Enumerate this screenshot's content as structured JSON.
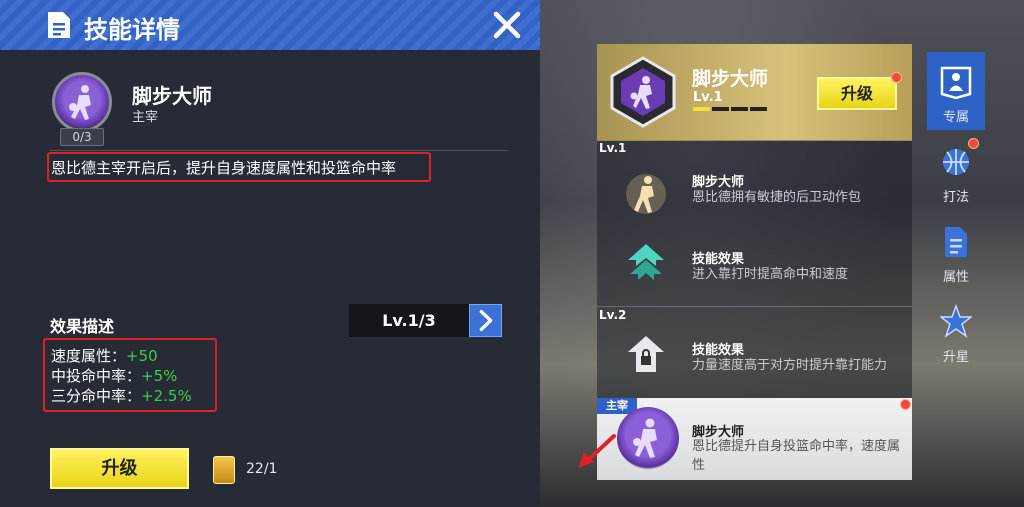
{
  "header": {
    "title": "技能详情",
    "icon": "document-icon",
    "close_icon": "close-icon"
  },
  "skill": {
    "name": "脚步大师",
    "type": "主宰",
    "progress": "0/3",
    "description": "恩比德主宰开启后，提升自身速度属性和投篮命中率"
  },
  "effect": {
    "title": "效果描述",
    "level": "Lv.1/3",
    "stats": [
      {
        "label": "速度属性：",
        "value": "+50"
      },
      {
        "label": "中投命中率：",
        "value": "+5%"
      },
      {
        "label": "三分命中率：",
        "value": "+2.5%"
      }
    ]
  },
  "upgrade_label": "升级",
  "card_count": "22/1",
  "panel": {
    "top": {
      "name": "脚步大师",
      "level": "Lv.1",
      "level_fill": 0.25,
      "upgrade_label": "升级"
    },
    "lv1_label": "Lv.1",
    "lv2_label": "Lv.2",
    "rows": [
      {
        "name": "脚步大师",
        "desc": "恩比德拥有敏捷的后卫动作包"
      },
      {
        "name": "技能效果",
        "desc": "进入靠打时提高命中和速度"
      },
      {
        "name": "技能效果",
        "desc": "力量速度高于对方时提升靠打能力"
      }
    ],
    "master": {
      "tag": "主宰",
      "name": "脚步大师",
      "desc": "恩比德提升自身投篮命中率，速度属性"
    }
  },
  "tabs": [
    {
      "label": "专属",
      "icon": "player-icon",
      "active": true
    },
    {
      "label": "打法",
      "icon": "basketball-icon",
      "active": false
    },
    {
      "label": "属性",
      "icon": "document-icon",
      "active": false
    },
    {
      "label": "升星",
      "icon": "star-icon",
      "active": false
    }
  ],
  "colors": {
    "accent_blue": "#2f62c6",
    "upgrade_yellow": "#f2e23a",
    "highlight_red": "#e0202a",
    "stat_green": "#36d24a"
  }
}
